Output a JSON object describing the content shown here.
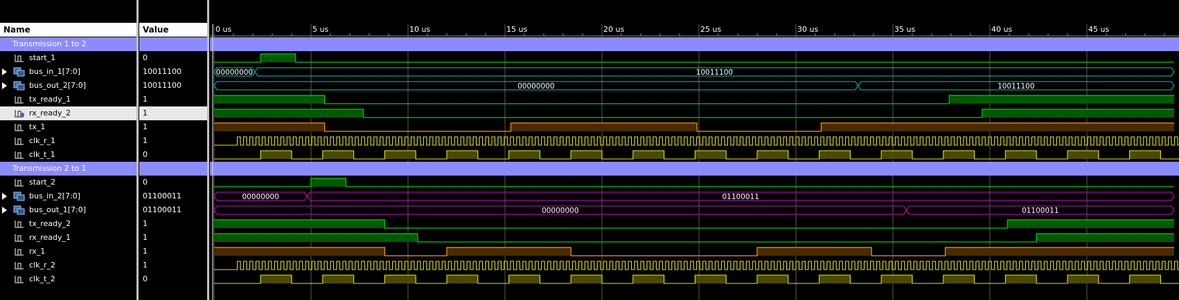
{
  "columns": {
    "name": "Name",
    "value": "Value"
  },
  "time_axis": {
    "labels": [
      "0 us",
      "5 us",
      "10 us",
      "15 us",
      "20 us",
      "25 us",
      "30 us",
      "35 us",
      "40 us",
      "45 us"
    ],
    "view_end_us": 49.5
  },
  "colors": {
    "group_bar": "#8b8bff",
    "bit_line": "#00d000",
    "bit_fill": "#005a00",
    "clock_line": "#e8e800",
    "clock_fill": "#4a4a00",
    "tx_line": "#ff9a00",
    "tx_fill": "#4a2a00",
    "bus_in_cyan": "#00c8c8",
    "bus_magenta": "#e000e0",
    "gridline": "#808080",
    "cursor": "#ffff00"
  },
  "rows": [
    {
      "kind": "group",
      "name": "Transmission 1 to 2",
      "value": ""
    },
    {
      "kind": "bit",
      "name": "start_1",
      "value": "0",
      "style": "bit",
      "edges": [
        [
          0,
          0
        ],
        [
          2.4,
          1
        ],
        [
          4.2,
          0
        ]
      ]
    },
    {
      "kind": "bus",
      "name": "bus_in_1[7:0]",
      "value": "10011100",
      "style": "cyan",
      "segments": [
        {
          "from": 0,
          "to": 2.1,
          "label": "00000000"
        },
        {
          "from": 2.1,
          "to": 49.5,
          "label": "10011100"
        }
      ]
    },
    {
      "kind": "bus",
      "name": "bus_out_2[7:0]",
      "value": "10011100",
      "style": "cyan",
      "segments": [
        {
          "from": 0,
          "to": 33.2,
          "label": "00000000"
        },
        {
          "from": 33.2,
          "to": 49.5,
          "label": "10011100"
        }
      ]
    },
    {
      "kind": "bit",
      "name": "tx_ready_1",
      "value": "1",
      "style": "bit",
      "edges": [
        [
          0,
          1
        ],
        [
          5.7,
          0
        ],
        [
          37.9,
          1
        ]
      ]
    },
    {
      "kind": "bit",
      "name": "rx_ready_2",
      "value": "1",
      "style": "bit",
      "selected": true,
      "edges": [
        [
          0,
          1
        ],
        [
          7.7,
          0
        ],
        [
          39.6,
          1
        ]
      ]
    },
    {
      "kind": "bit",
      "name": "tx_1",
      "value": "1",
      "style": "tx",
      "edges": [
        [
          0,
          1
        ],
        [
          5.7,
          0
        ],
        [
          15.3,
          1
        ],
        [
          24.9,
          0
        ],
        [
          31.3,
          1
        ]
      ]
    },
    {
      "kind": "clock",
      "name": "clk_r_1",
      "value": "1",
      "style": "clock",
      "start": 1.2,
      "period": 0.32
    },
    {
      "kind": "clock",
      "name": "clk_t_1",
      "value": "0",
      "style": "clock",
      "start": 2.4,
      "period": 3.2,
      "duty": 0.5
    },
    {
      "kind": "group",
      "name": "Transmission 2 to 1",
      "value": ""
    },
    {
      "kind": "bit",
      "name": "start_2",
      "value": "0",
      "style": "bit",
      "edges": [
        [
          0,
          0
        ],
        [
          5.0,
          1
        ],
        [
          6.8,
          0
        ]
      ]
    },
    {
      "kind": "bus",
      "name": "bus_in_2[7:0]",
      "value": "01100011",
      "style": "magenta",
      "segments": [
        {
          "from": 0,
          "to": 4.8,
          "label": "00000000"
        },
        {
          "from": 4.8,
          "to": 49.5,
          "label": "01100011"
        }
      ]
    },
    {
      "kind": "bus",
      "name": "bus_out_1[7:0]",
      "value": "01100011",
      "style": "magenta",
      "segments": [
        {
          "from": 0,
          "to": 35.7,
          "label": "00000000"
        },
        {
          "from": 35.7,
          "to": 49.5,
          "label": "01100011"
        }
      ]
    },
    {
      "kind": "bit",
      "name": "tx_ready_2",
      "value": "1",
      "style": "bit",
      "edges": [
        [
          0,
          1
        ],
        [
          8.8,
          0
        ],
        [
          40.9,
          1
        ]
      ]
    },
    {
      "kind": "bit",
      "name": "rx_ready_1",
      "value": "1",
      "style": "bit",
      "edges": [
        [
          0,
          1
        ],
        [
          10.5,
          0
        ],
        [
          42.4,
          1
        ]
      ]
    },
    {
      "kind": "bit",
      "name": "rx_1",
      "value": "1",
      "style": "tx",
      "edges": [
        [
          0,
          1
        ],
        [
          8.8,
          0
        ],
        [
          12.0,
          1
        ],
        [
          18.4,
          0
        ],
        [
          28.0,
          1
        ],
        [
          33.9,
          0
        ],
        [
          37.7,
          1
        ]
      ]
    },
    {
      "kind": "clock",
      "name": "clk_r_2",
      "value": "1",
      "style": "clock",
      "start": 1.2,
      "period": 0.32
    },
    {
      "kind": "clock",
      "name": "clk_t_2",
      "value": "0",
      "style": "clock",
      "start": 2.4,
      "period": 3.2,
      "duty": 0.5
    }
  ]
}
